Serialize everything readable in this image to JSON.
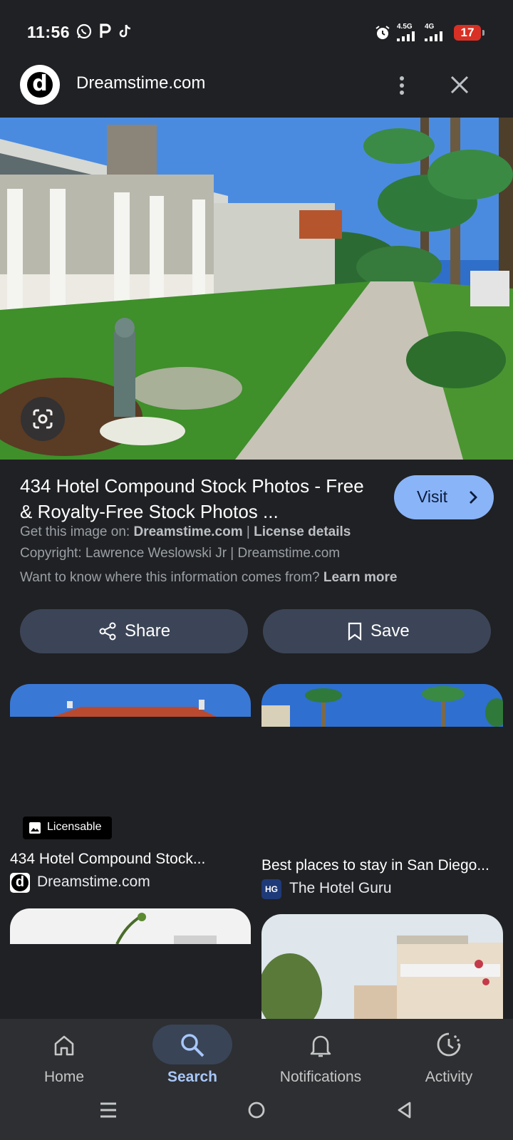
{
  "status_bar": {
    "time": "11:56",
    "net1": "4.5G",
    "net2": "4G",
    "battery": "17"
  },
  "header": {
    "logo_letter": "d",
    "title": "Dreamstime.com"
  },
  "result": {
    "title": "434 Hotel Compound Stock Photos - Free & Royalty-Free Stock Photos ...",
    "visit_label": "Visit",
    "get_image_prefix": "Get this image on:",
    "get_image_source": "Dreamstime.com",
    "separator": "|",
    "license_label": "License details",
    "copyright": "Copyright: Lawrence Weslowski Jr | Dreamstime.com",
    "info_question": "Want to know where this information comes from?",
    "learn_more": "Learn more"
  },
  "actions": {
    "share": "Share",
    "save": "Save"
  },
  "related": [
    {
      "badge": "Licensable",
      "title": "434 Hotel Compound Stock...",
      "source": "Dreamstime.com",
      "source_letter": "d"
    },
    {
      "title": "Best places to stay in San Diego...",
      "source": "The Hotel Guru",
      "source_letter": "HG"
    }
  ],
  "bottom_nav": {
    "items": [
      {
        "label": "Home"
      },
      {
        "label": "Search"
      },
      {
        "label": "Notifications"
      },
      {
        "label": "Activity"
      }
    ],
    "active": "Search"
  },
  "colors": {
    "background": "#202124",
    "accent": "#8ab4f8",
    "button": "#3c4557"
  }
}
